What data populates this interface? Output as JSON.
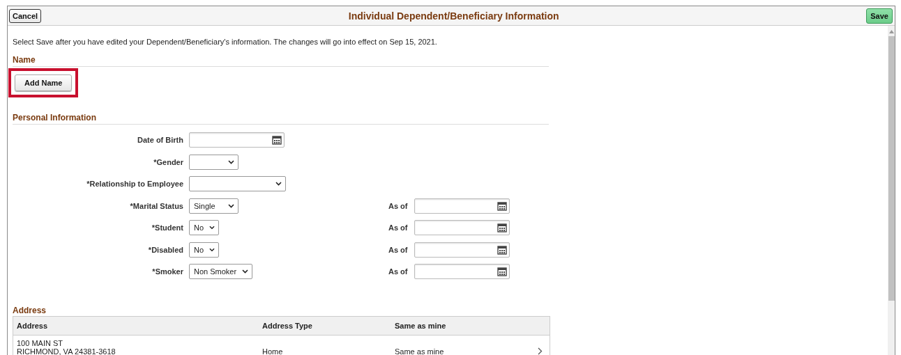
{
  "header": {
    "cancel": "Cancel",
    "title": "Individual Dependent/Beneficiary Information",
    "save": "Save"
  },
  "instruction": "Select Save after you have edited your Dependent/Beneficiary's information.  The changes will go into effect on Sep 15, 2021.",
  "name_section": {
    "heading": "Name",
    "button": {
      "label": "Add Name",
      "highlighted": true
    }
  },
  "personal_section": {
    "heading": "Personal Information",
    "fields": [
      {
        "label": "Date of Birth",
        "kind": "date"
      },
      {
        "label": "*Gender",
        "kind": "select"
      },
      {
        "label": "*Relationship to Employee",
        "kind": "select"
      },
      {
        "label": "*Marital Status",
        "kind": "select",
        "value": "Single",
        "as_of": {
          "label": "As of"
        }
      },
      {
        "label": "*Student",
        "kind": "select",
        "value": "No",
        "as_of": {
          "label": "As of"
        }
      },
      {
        "label": "*Disabled",
        "kind": "select",
        "value": "No",
        "as_of": {
          "label": "As of"
        }
      },
      {
        "label": "*Smoker",
        "kind": "select",
        "value": "Non Smoker",
        "as_of": {
          "label": "As of"
        }
      }
    ]
  },
  "address_section": {
    "heading": "Address",
    "table": {
      "columns": [
        "Address",
        "Address Type",
        "Same as mine"
      ],
      "rows": [
        {
          "address": [
            "100 MAIN ST",
            "RICHMOND, VA 24381-3618"
          ],
          "type": "Home",
          "same": "Same as mine"
        }
      ]
    }
  }
}
